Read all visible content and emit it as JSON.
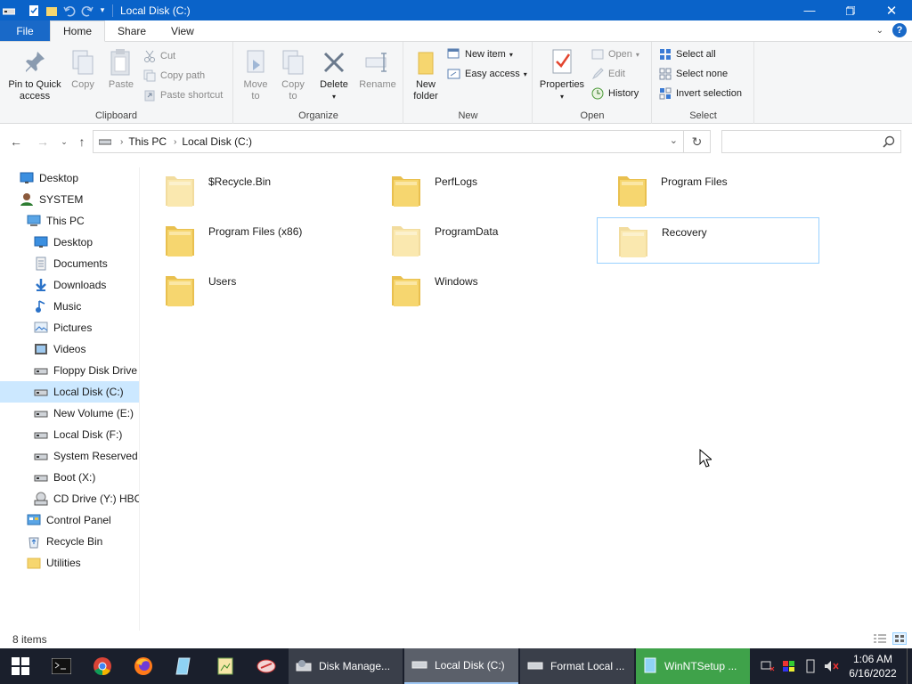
{
  "window": {
    "title": "Local Disk (C:)",
    "icons": [
      "drive-icon",
      "properties-icon",
      "new-folder-icon",
      "undo-icon",
      "redo-icon",
      "customize-qat-icon"
    ]
  },
  "ribbon": {
    "tabs": [
      "File",
      "Home",
      "Share",
      "View"
    ],
    "active_tab": "Home",
    "groups": {
      "clipboard": {
        "label": "Clipboard",
        "pin": "Pin to Quick access",
        "pin_l1": "Pin to Quick",
        "pin_l2": "access",
        "copy": "Copy",
        "paste": "Paste",
        "cut": "Cut",
        "copy_path": "Copy path",
        "paste_shortcut": "Paste shortcut"
      },
      "organize": {
        "label": "Organize",
        "move_l1": "Move",
        "move_l2": "to",
        "copy_l1": "Copy",
        "copy_l2": "to",
        "delete": "Delete",
        "rename": "Rename"
      },
      "new": {
        "label": "New",
        "folder_l1": "New",
        "folder_l2": "folder",
        "new_item": "New item",
        "easy_access": "Easy access"
      },
      "open": {
        "label": "Open",
        "properties": "Properties",
        "open": "Open",
        "edit": "Edit",
        "history": "History"
      },
      "select": {
        "label": "Select",
        "select_all": "Select all",
        "select_none": "Select none",
        "invert": "Invert selection"
      }
    }
  },
  "address": {
    "crumbs": [
      "This PC",
      "Local Disk (C:)"
    ],
    "search_placeholder": ""
  },
  "navpane": {
    "items": [
      {
        "label": "Desktop",
        "icon": "desktop-icon"
      },
      {
        "label": "SYSTEM",
        "icon": "user-icon"
      },
      {
        "label": "This PC",
        "icon": "computer-icon"
      },
      {
        "label": "Desktop",
        "icon": "desktop-icon"
      },
      {
        "label": "Documents",
        "icon": "documents-icon"
      },
      {
        "label": "Downloads",
        "icon": "downloads-icon"
      },
      {
        "label": "Music",
        "icon": "music-icon"
      },
      {
        "label": "Pictures",
        "icon": "pictures-icon"
      },
      {
        "label": "Videos",
        "icon": "videos-icon"
      },
      {
        "label": "Floppy Disk Drive",
        "icon": "floppy-icon"
      },
      {
        "label": "Local Disk (C:)",
        "icon": "drive-icon",
        "selected": true
      },
      {
        "label": "New Volume (E:)",
        "icon": "drive-icon"
      },
      {
        "label": "Local Disk (F:)",
        "icon": "drive-icon"
      },
      {
        "label": "System Reserved (",
        "icon": "drive-icon"
      },
      {
        "label": "Boot (X:)",
        "icon": "drive-icon"
      },
      {
        "label": "CD Drive (Y:) HBC",
        "icon": "cd-drive-icon"
      },
      {
        "label": "Control Panel",
        "icon": "control-panel-icon"
      },
      {
        "label": "Recycle Bin",
        "icon": "recycle-bin-icon"
      },
      {
        "label": "Utilities",
        "icon": "folder-icon"
      }
    ]
  },
  "files": [
    {
      "name": "$Recycle.Bin",
      "faded": true
    },
    {
      "name": "PerfLogs",
      "faded": false
    },
    {
      "name": "Program Files",
      "faded": false
    },
    {
      "name": "Program Files (x86)",
      "faded": false
    },
    {
      "name": "ProgramData",
      "faded": true
    },
    {
      "name": "Recovery",
      "faded": true,
      "selected": true
    },
    {
      "name": "Users",
      "faded": false
    },
    {
      "name": "Windows",
      "faded": false
    }
  ],
  "status": {
    "item_count": "8 items"
  },
  "taskbar": {
    "pinned": [
      "start-icon",
      "cmd-icon",
      "chrome-icon",
      "firefox-icon",
      "notepad-icon",
      "image-tool-icon",
      "tool-icon"
    ],
    "windows": [
      {
        "label": "Disk Manage..."
      },
      {
        "label": "Local Disk (C:)"
      },
      {
        "label": "Format Local ..."
      },
      {
        "label": "WinNTSetup ..."
      }
    ],
    "time": "1:06 AM",
    "date": "6/16/2022"
  },
  "colors": {
    "titlebar": "#0a63c9",
    "file_tab": "#1969c8",
    "selection": "#cce8ff",
    "taskbar": "#1a1f2c",
    "folder": "#f6d66f"
  }
}
